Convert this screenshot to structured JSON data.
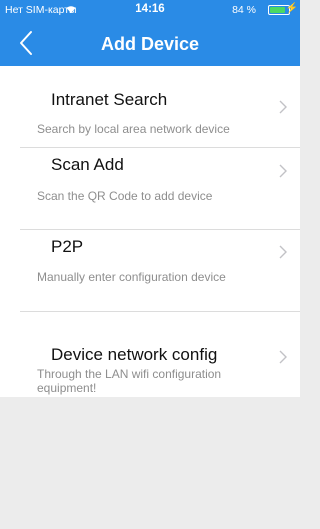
{
  "status_bar": {
    "carrier": "Нет SIM-карты",
    "time": "14:16",
    "battery": "84 %"
  },
  "header": {
    "title": "Add Device",
    "back_icon": "chevron-left-icon"
  },
  "colors": {
    "header_bg": "#2a8be6",
    "battery_fill": "#4cd964"
  },
  "items": [
    {
      "label": "Intranet Search",
      "description": "Search by local area network device"
    },
    {
      "label": "Scan Add",
      "description": "Scan the QR Code to add device"
    },
    {
      "label": "P2P",
      "description": "Manually enter configuration device"
    },
    {
      "label": "Device network config",
      "description": "Through the LAN wifi configuration equipment!"
    }
  ]
}
